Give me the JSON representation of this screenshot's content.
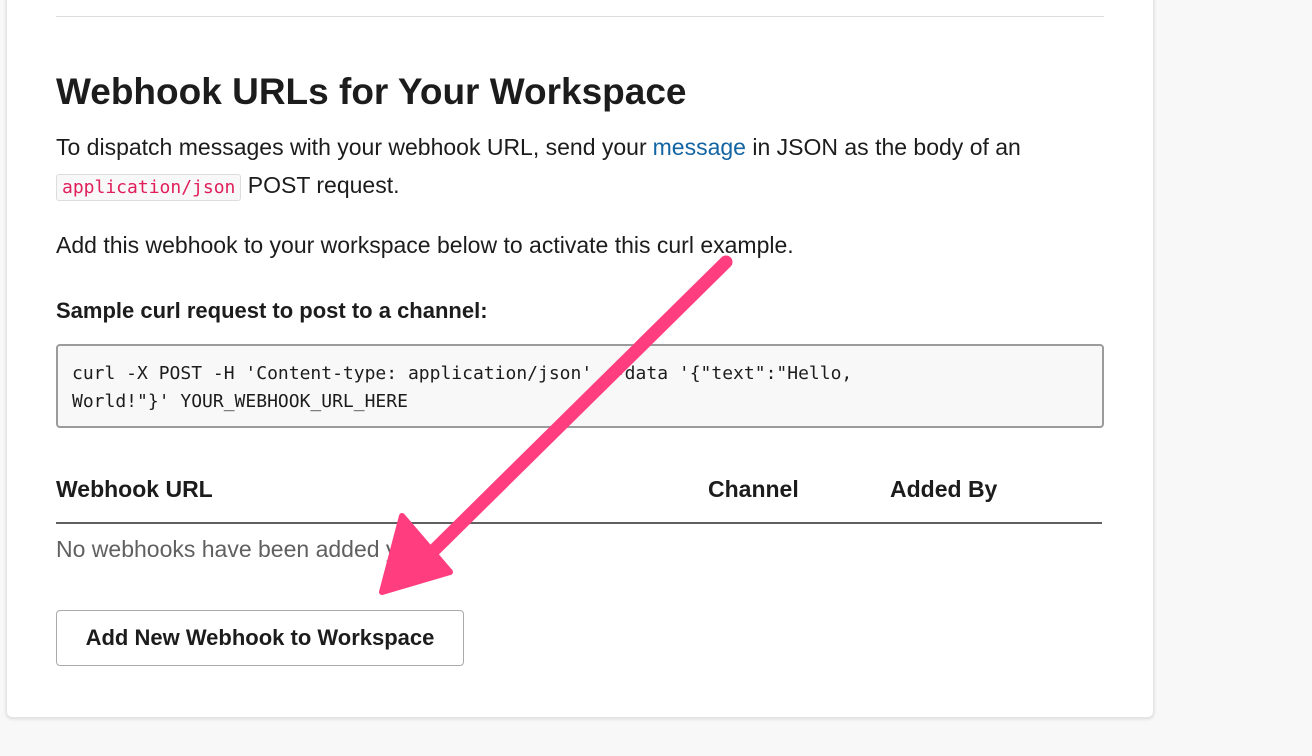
{
  "section": {
    "title": "Webhook URLs for Your Workspace",
    "intro_before_link": "To dispatch messages with your webhook URL, send your",
    "intro_link": "message",
    "intro_after_link": " in JSON as the body of an ",
    "intro_code": "application/json",
    "intro_end": " POST request.",
    "activate_note": "Add this webhook to your workspace below to activate this curl example.",
    "sample_label": "Sample curl request to post to a channel:",
    "sample_code": "curl -X POST -H 'Content-type: application/json' --data '{\"text\":\"Hello,\nWorld!\"}' YOUR_WEBHOOK_URL_HERE"
  },
  "table": {
    "columns": [
      "Webhook URL",
      "Channel",
      "Added By"
    ],
    "empty_message": "No webhooks have been added yet."
  },
  "actions": {
    "add_button_label": "Add New Webhook to Workspace"
  },
  "colors": {
    "link": "#1264a3",
    "inline_code": "#e01e5a",
    "annotation_arrow": "#ff3d7f"
  }
}
